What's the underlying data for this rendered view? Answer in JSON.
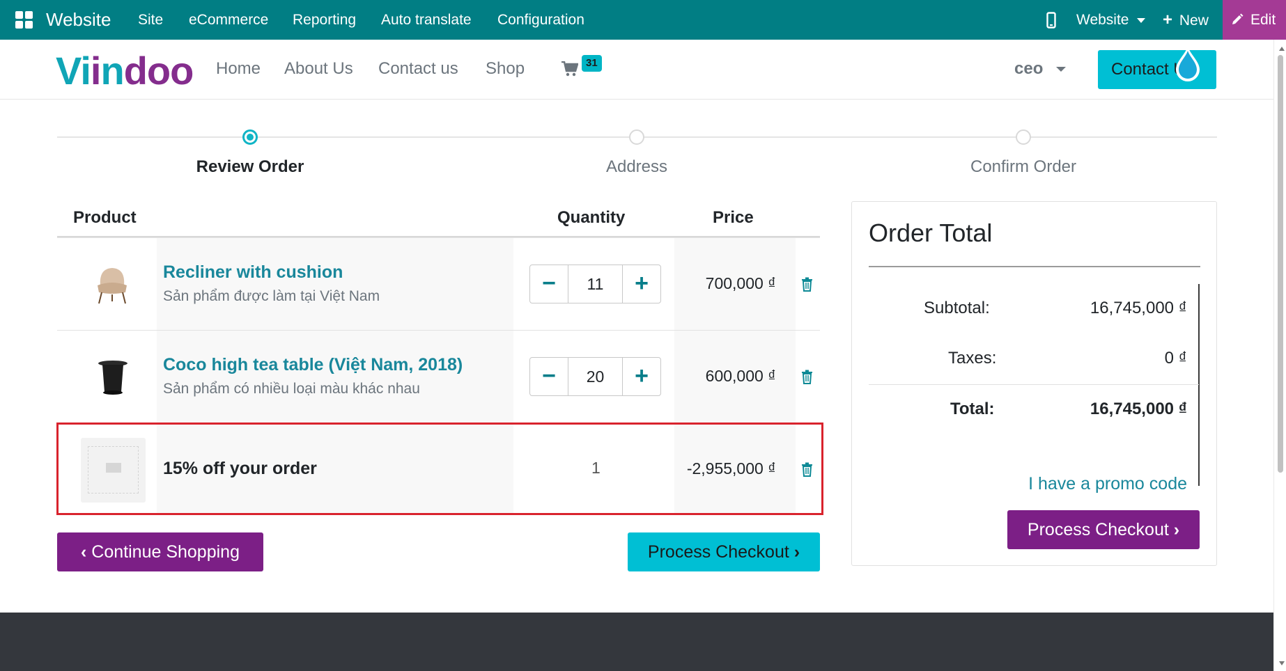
{
  "admin_bar": {
    "app_name": "Website",
    "menu": [
      "Site",
      "eCommerce",
      "Reporting",
      "Auto translate",
      "Configuration"
    ],
    "website_selector": "Website",
    "new_label": "New",
    "edit_label": "Edit"
  },
  "site": {
    "logo": {
      "part1": "Vi",
      "part2": "i",
      "part3": "n",
      "part4": "doo"
    },
    "nav": [
      "Home",
      "About Us",
      "Contact us",
      "Shop"
    ],
    "cart_count": "31",
    "user": "ceo",
    "contact_btn": "Contact Us"
  },
  "steps": [
    {
      "label": "Review Order",
      "active": true
    },
    {
      "label": "Address",
      "active": false
    },
    {
      "label": "Confirm Order",
      "active": false
    }
  ],
  "table": {
    "headers": {
      "product": "Product",
      "quantity": "Quantity",
      "price": "Price"
    },
    "rows": [
      {
        "name": "Recliner with cushion",
        "desc": "Sản phẩm được làm tại Việt Nam",
        "qty": "11",
        "price": "700,000 ₫"
      },
      {
        "name": "Coco high tea table (Việt Nam, 2018)",
        "desc": "Sản phẩm có nhiều loại màu khác nhau",
        "qty": "20",
        "price": "600,000 ₫"
      },
      {
        "name": "15% off your order",
        "qty": "1",
        "price": "-2,955,000 ₫"
      }
    ]
  },
  "buttons": {
    "continue_shopping": "Continue Shopping",
    "process_checkout": "Process Checkout"
  },
  "order_total": {
    "title": "Order Total",
    "subtotal_label": "Subtotal:",
    "subtotal_value": "16,745,000 ₫",
    "taxes_label": "Taxes:",
    "taxes_value": "0 ₫",
    "total_label": "Total:",
    "total_value": "16,745,000 ₫",
    "promo_link": "I have a promo code",
    "checkout_btn": "Process Checkout"
  },
  "colors": {
    "admin_bar": "#017e84",
    "edit": "#a43a95",
    "primary": "#00bfd4",
    "secondary": "#7c1f86",
    "link": "#19879b",
    "highlight": "#d9232d"
  }
}
